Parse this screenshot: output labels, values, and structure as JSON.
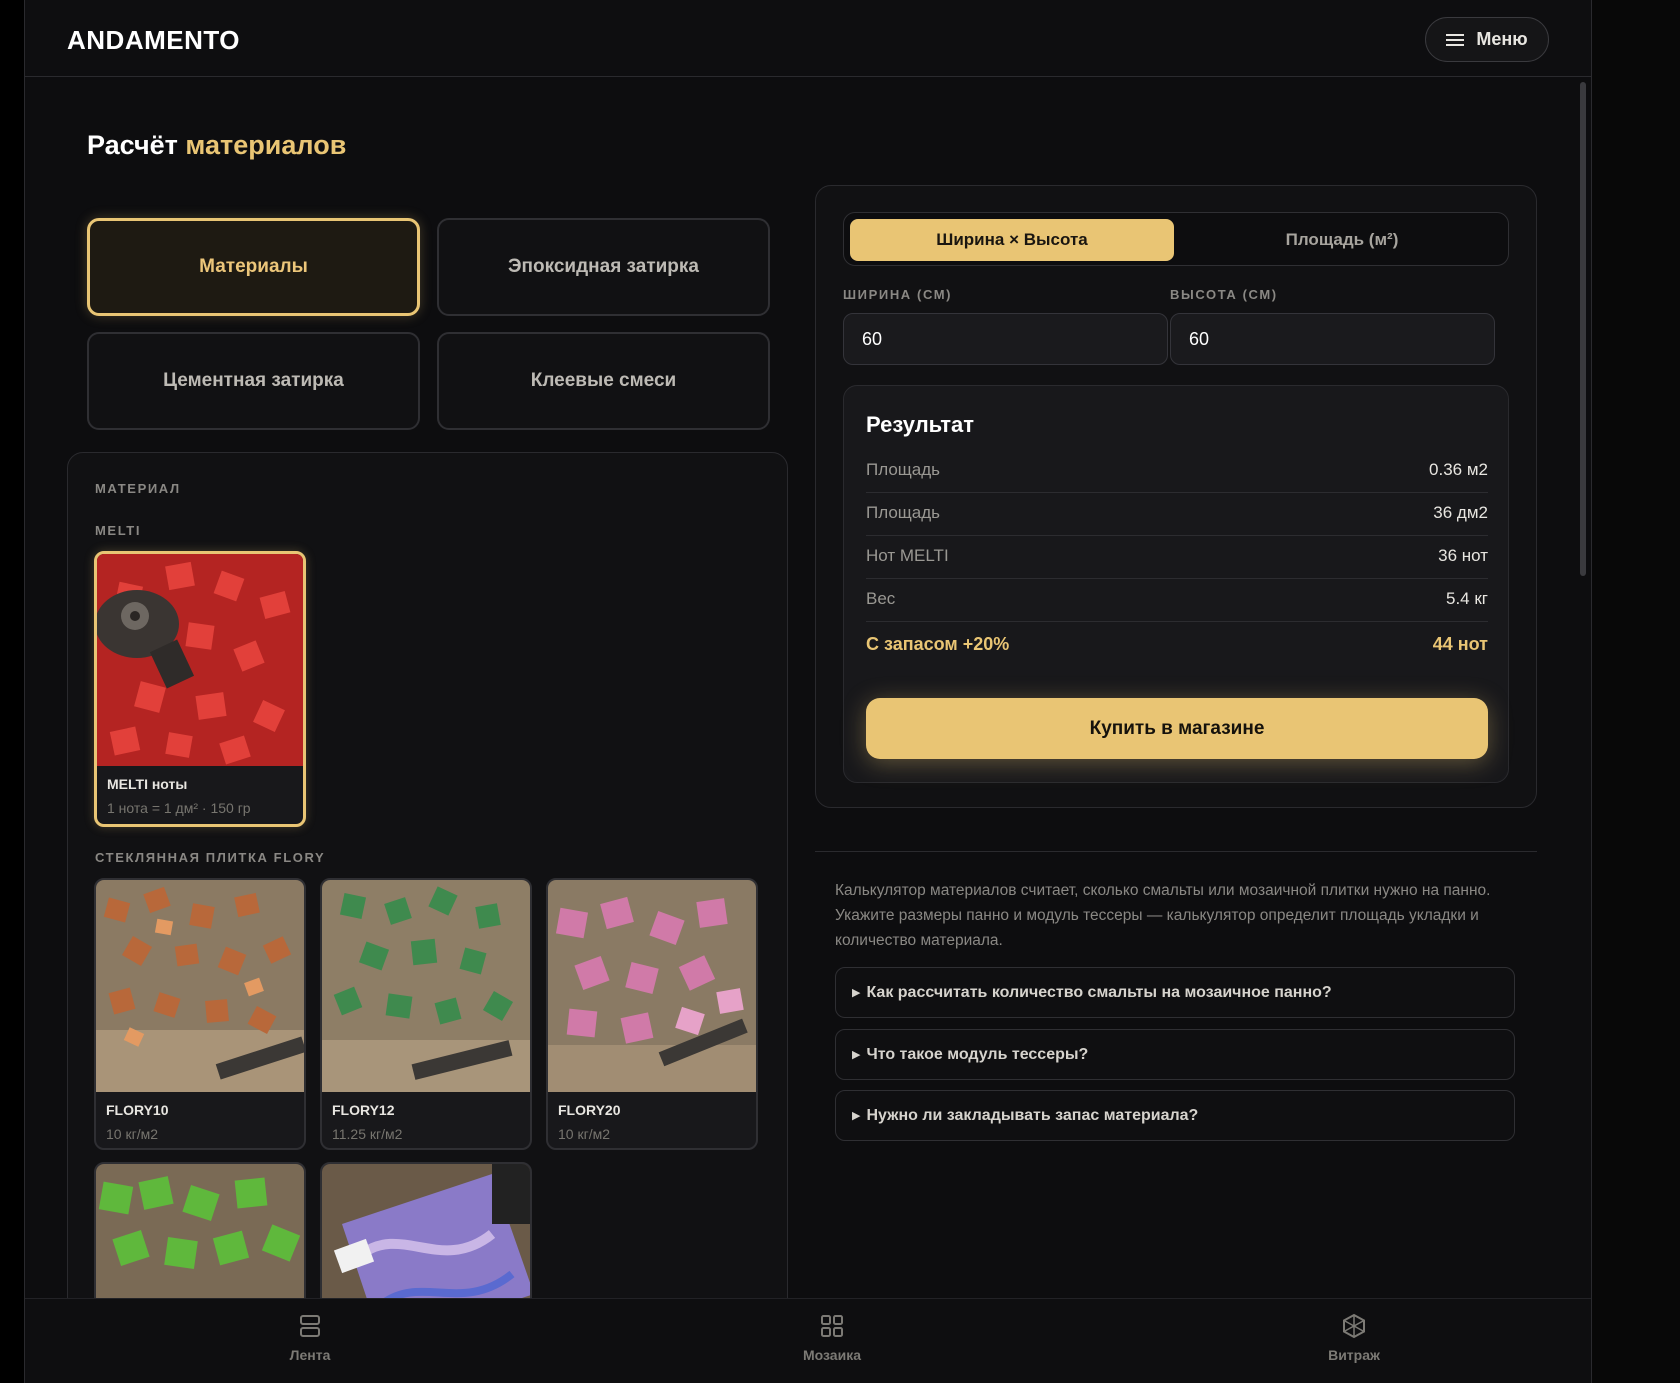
{
  "header": {
    "logo": "ANDAMENTO",
    "menu_label": "Меню"
  },
  "page": {
    "title_main": "Расчёт",
    "title_accent": "материалов"
  },
  "tabs": [
    {
      "label": "Материалы",
      "active": true
    },
    {
      "label": "Эпоксидная затирка",
      "active": false
    },
    {
      "label": "Цементная затирка",
      "active": false
    },
    {
      "label": "Клеевые смеси",
      "active": false
    }
  ],
  "materials": {
    "section_label": "МАТЕРИАЛ",
    "groups": [
      {
        "label": "MELTI",
        "items": [
          {
            "name": "MELTI ноты",
            "sub": "1 нота = 1 дм² · 150 гр",
            "selected": true,
            "color": "#d8322f"
          }
        ]
      },
      {
        "label": "СТЕКЛЯННАЯ ПЛИТКА FLORY",
        "items": [
          {
            "name": "FLORY10",
            "sub": "10 кг/м2",
            "selected": false,
            "color": "#b06a3e"
          },
          {
            "name": "FLORY12",
            "sub": "11.25 кг/м2",
            "selected": false,
            "color": "#3f8a4e"
          },
          {
            "name": "FLORY20",
            "sub": "10 кг/м2",
            "selected": false,
            "color": "#d07aa8"
          },
          {
            "name": "",
            "sub": "",
            "selected": false,
            "color": "#5fb83c"
          },
          {
            "name": "",
            "sub": "",
            "selected": false,
            "color": "#8a7ac8"
          }
        ]
      }
    ]
  },
  "calculator": {
    "mode_options": [
      "Ширина × Высота",
      "Площадь (м²)"
    ],
    "active_mode": 0,
    "width_label": "ШИРИНА (СМ)",
    "height_label": "ВЫСОТА (СМ)",
    "width_value": "60",
    "height_value": "60",
    "result_title": "Результат",
    "rows": [
      {
        "label": "Площадь",
        "value": "0.36 м2"
      },
      {
        "label": "Площадь",
        "value": "36 дм2"
      },
      {
        "label": "Нот MELTI",
        "value": "36 нот"
      },
      {
        "label": "Вес",
        "value": "5.4 кг"
      }
    ],
    "total": {
      "label": "С запасом +20%",
      "value": "44 нот"
    },
    "buy_label": "Купить в магазине"
  },
  "info": {
    "description": "Калькулятор материалов считает, сколько смальты или мозаичной плитки нужно на панно. Укажите размеры панно и модуль тессеры — калькулятор определит площадь укладки и количество материала.",
    "faq": [
      "Как рассчитать количество смальты на мозаичное панно?",
      "Что такое модуль тессеры?",
      "Нужно ли закладывать запас материала?"
    ]
  },
  "bottom_nav": [
    {
      "label": "Лента",
      "icon": "feed-icon"
    },
    {
      "label": "Мозаика",
      "icon": "grid-icon"
    },
    {
      "label": "Витраж",
      "icon": "stained-glass-icon"
    }
  ],
  "colors": {
    "accent": "#e9c574",
    "background": "#0d0d0f",
    "panel": "#111113"
  }
}
